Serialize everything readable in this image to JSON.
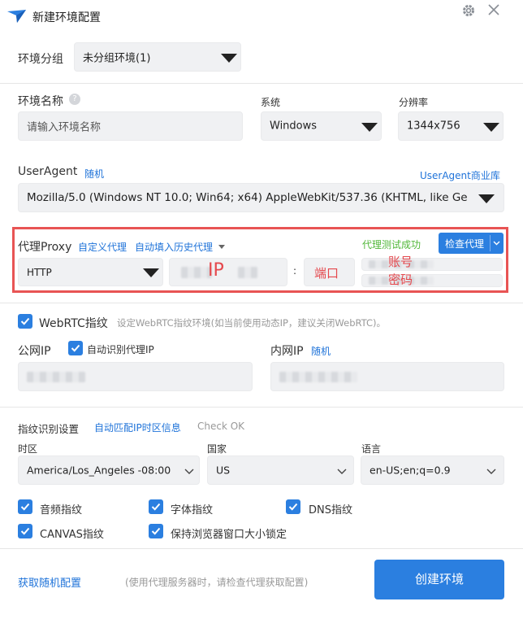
{
  "window": {
    "title": "新建环境配置"
  },
  "group": {
    "label": "环境分组",
    "value": "未分组环境(1)"
  },
  "env_name": {
    "label": "环境名称",
    "placeholder": "请输入环境名称"
  },
  "system": {
    "label": "系统",
    "value": "Windows"
  },
  "resolution": {
    "label": "分辨率",
    "value": "1344x756"
  },
  "useragent": {
    "label": "UserAgent",
    "random_link": "随机",
    "store_link": "UserAgent商业库",
    "value": "Mozilla/5.0 (Windows NT 10.0; Win64; x64) AppleWebKit/537.36 (KHTML, like Ge"
  },
  "proxy": {
    "label": "代理Proxy",
    "custom_link": "自定义代理",
    "history_link": "自动填入历史代理",
    "status": "代理测试成功",
    "check_button": "检查代理",
    "protocol": "HTTP",
    "ip_annotation": "IP",
    "colon": ":",
    "port_annotation": "端口",
    "account_annotation": "账号",
    "password_annotation": "密码"
  },
  "webrtc": {
    "label": "WebRTC指纹",
    "hint": "设定WebRTC指纹环境(如当前使用动态IP，建议关闭WebRTC)。"
  },
  "public_ip": {
    "label": "公网IP",
    "auto_label": "自动识别代理IP"
  },
  "local_ip": {
    "label": "内网IP",
    "random_link": "随机"
  },
  "fingerprint": {
    "label": "指纹识别设置",
    "match_link": "自动匹配IP时区信息",
    "check_status": "Check OK"
  },
  "timezone": {
    "label": "时区",
    "value": "America/Los_Angeles -08:00"
  },
  "country": {
    "label": "国家",
    "value": "US"
  },
  "language": {
    "label": "语言",
    "value": "en-US;en;q=0.9"
  },
  "checks": {
    "audio": "音频指纹",
    "font": "字体指纹",
    "dns": "DNS指纹",
    "canvas": "CANVAS指纹",
    "lock_size": "保持浏览器窗口大小锁定"
  },
  "footer": {
    "random_config": "获取随机配置",
    "note": "(使用代理服务器时，请检查代理获取配置)",
    "create_button": "创建环境"
  },
  "colors": {
    "accent": "#2b7fe0",
    "success": "#52b83a",
    "annotation": "#e5484d"
  }
}
